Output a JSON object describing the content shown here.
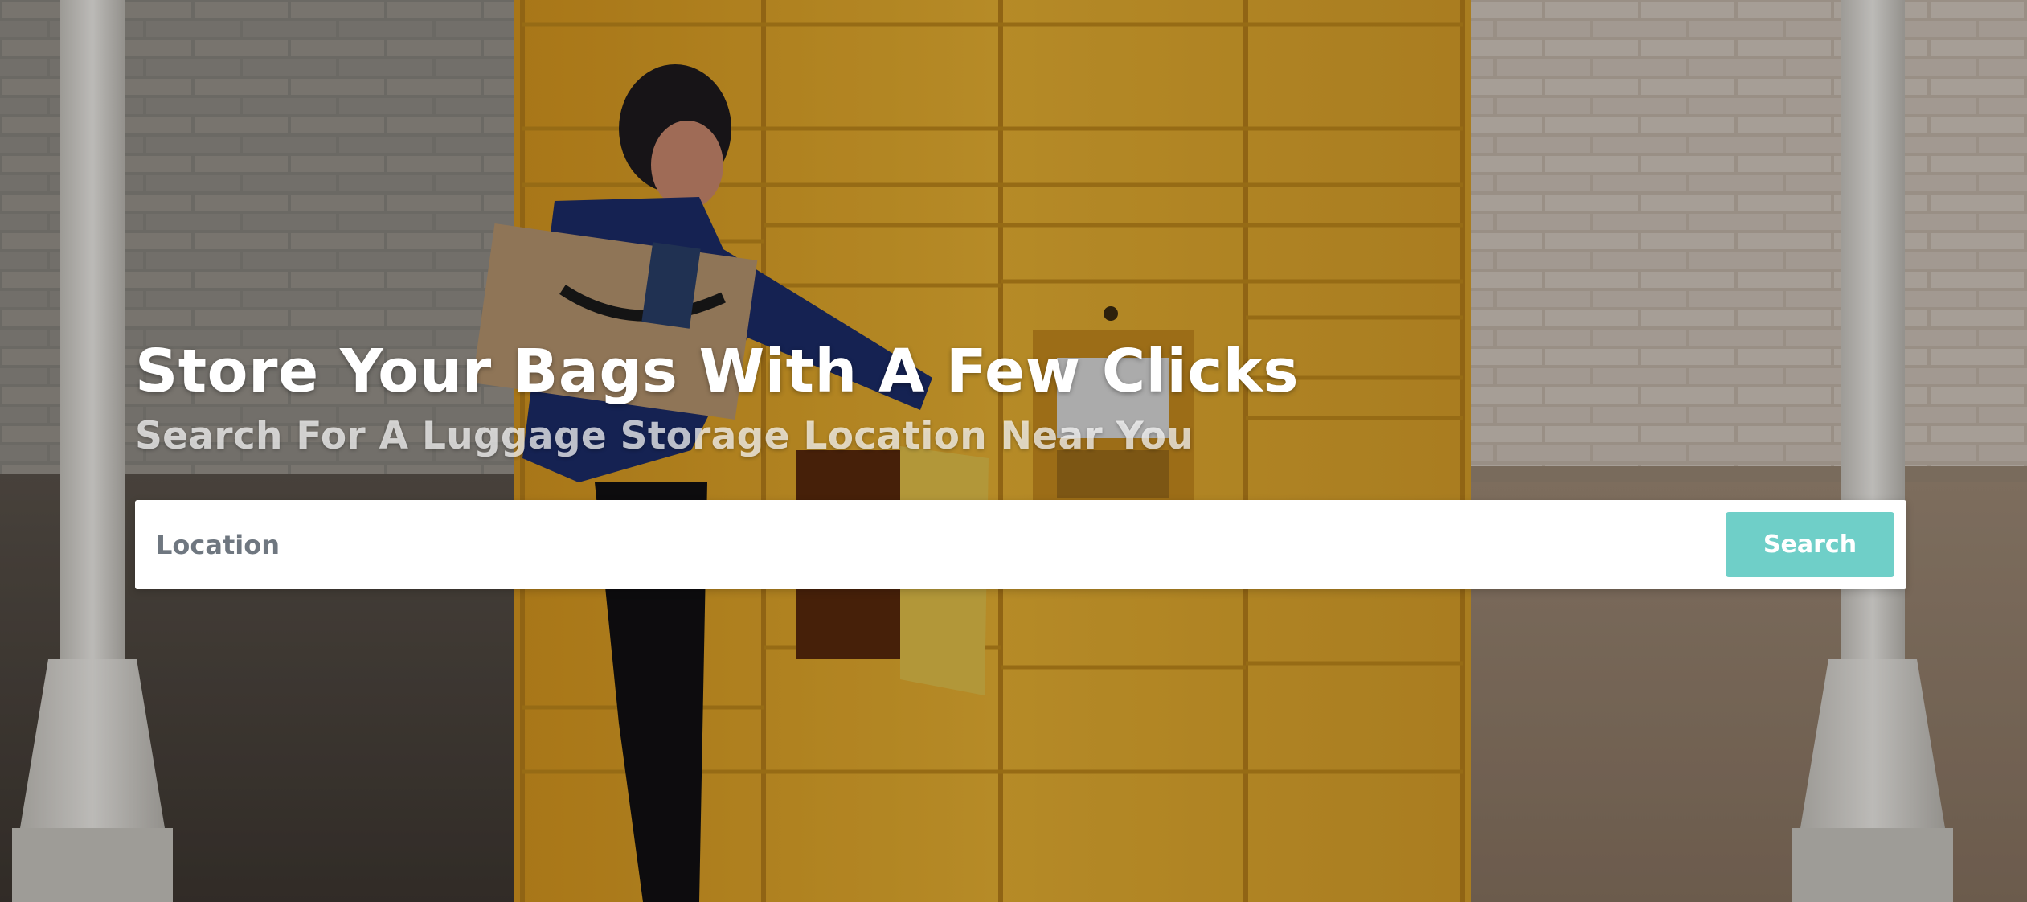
{
  "hero": {
    "title": "Store Your Bags With A Few Clicks",
    "subtitle": "Search For A Luggage Storage Location Near You"
  },
  "search": {
    "placeholder": "Location",
    "value": "",
    "button_label": "Search"
  },
  "colors": {
    "accent": "#6fcfc8",
    "locker_yellow": "#e8ae2b",
    "wall": "#cfc6bb",
    "overlay": "rgba(0,0,0,0.22)"
  },
  "icons": {
    "background": "amazon-locker-photo"
  }
}
